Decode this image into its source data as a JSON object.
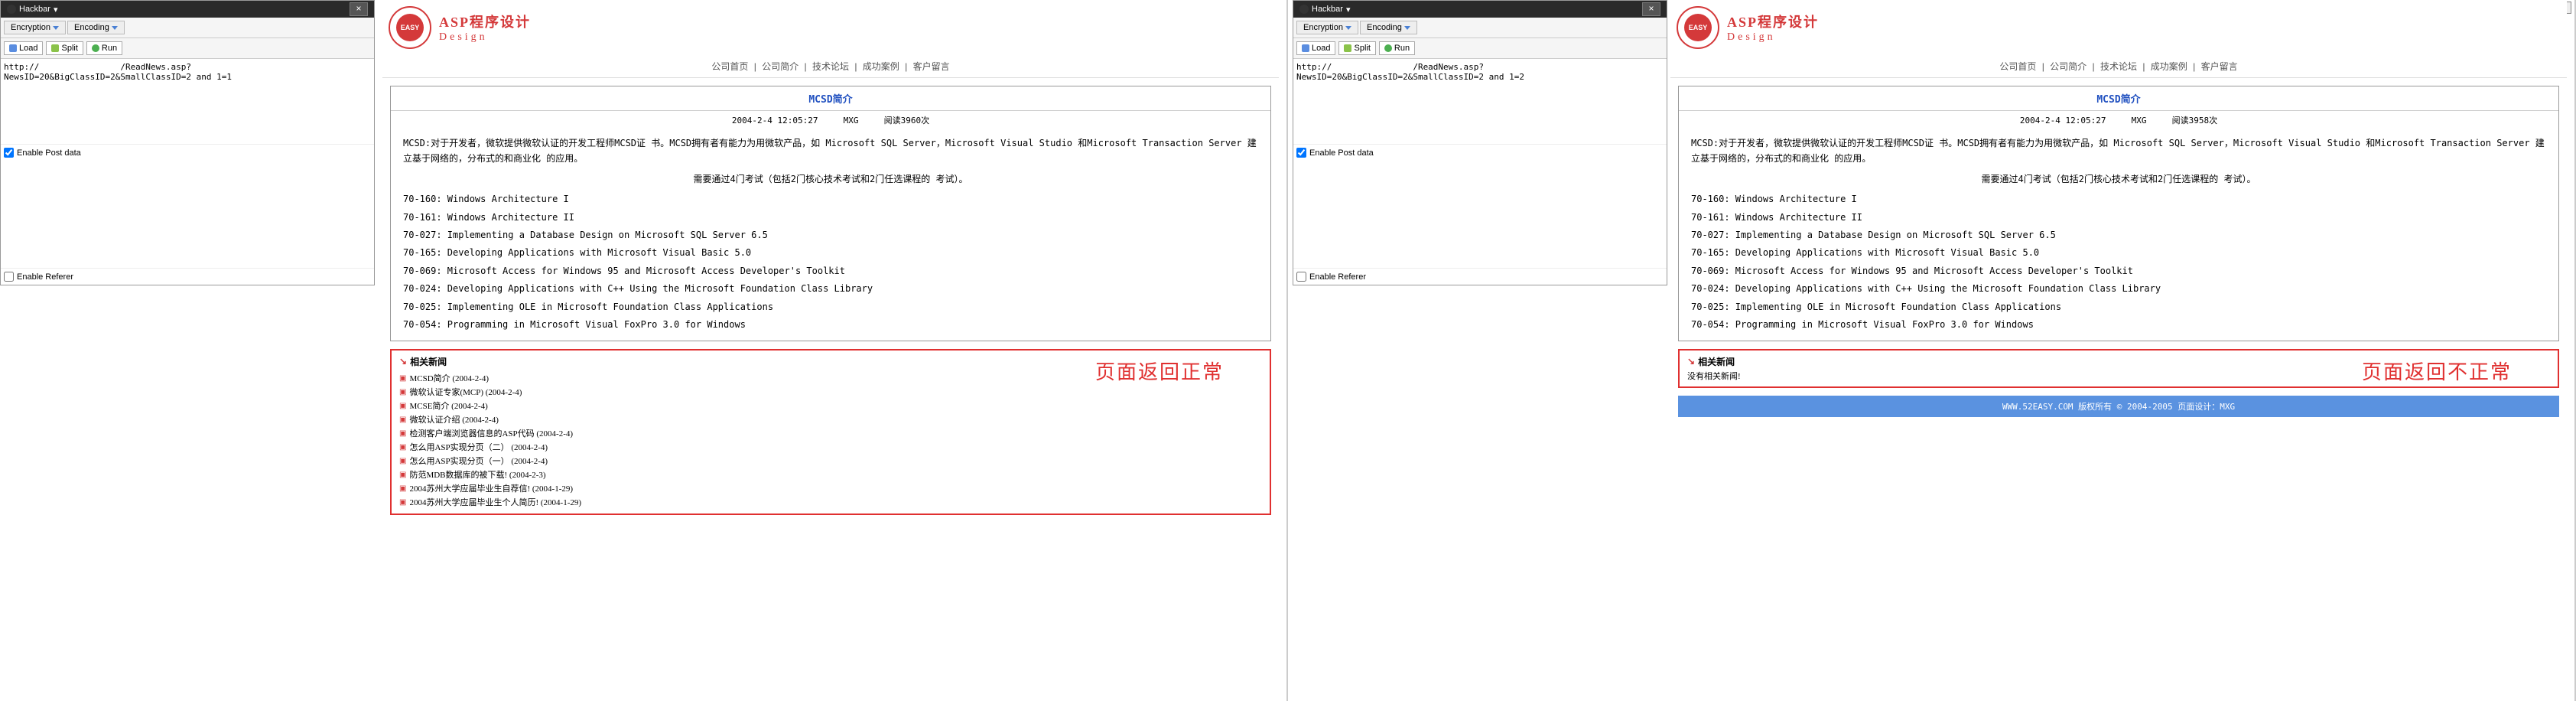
{
  "hackbar": {
    "title": "Hackbar",
    "encryption_label": "Encryption",
    "encoding_label": "Encoding",
    "load_label": "Load",
    "split_label": "Split",
    "run_label": "Run",
    "enable_post_label": "Enable Post data",
    "enable_referer_label": "Enable Referer"
  },
  "left": {
    "url_value": "http://                /ReadNews.asp?NewsID=20&BigClassID=2&SmallClassID=2 and 1=1",
    "post_checked": true,
    "referer_checked": false,
    "related_overlay": "页面返回正常",
    "meta_views": "阅读3960次",
    "related_items": [
      "MCSD简介 (2004-2-4)",
      "微软认证专家(MCP) (2004-2-4)",
      "MCSE简介 (2004-2-4)",
      "微软认证介绍 (2004-2-4)",
      "检测客户端浏览器信息的ASP代码 (2004-2-4)",
      "怎么用ASP实现分页（二） (2004-2-4)",
      "怎么用ASP实现分页（一） (2004-2-4)",
      "防范MDB数据库的被下载! (2004-2-3)",
      "2004苏州大学应届毕业生自荐信! (2004-1-29)",
      "2004苏州大学应届毕业生个人简历! (2004-1-29)"
    ]
  },
  "right": {
    "url_value": "http://                /ReadNews.asp?NewsID=20&BigClassID=2&SmallClassID=2 and 1=2",
    "post_checked": true,
    "referer_checked": false,
    "related_overlay": "页面返回不正常",
    "meta_views": "阅读3958次",
    "related_none": "没有相关新闻!",
    "win_min": "—",
    "win_close": "X"
  },
  "site": {
    "logo_text": "EASY",
    "title_main": "ASP程序设计",
    "title_sub": "Design",
    "nav_items": [
      "公司首页",
      "公司简介",
      "技术论坛",
      "成功案例",
      "客户留言"
    ],
    "nav_sep": " | ",
    "footer": "WWW.52EASY.COM 版权所有 © 2004-2005 页面设计：MXG"
  },
  "article": {
    "title": "MCSD简介",
    "meta_date": "2004-2-4 12:05:27",
    "meta_author": "MXG",
    "intro": "MCSD:对于开发者，微软提供微软认证的开发工程师MCSD证 书。MCSD拥有者有能力为用微软产品，如 Microsoft SQL Server，Microsoft Visual Studio 和Microsoft Transaction Server 建立基于网络的，分布式的和商业化 的应用。",
    "requirement": "需要通过4门考试（包括2门核心技术考试和2门任选课程的 考试）。",
    "certs": [
      "70-160: Windows Architecture I",
      "70-161: Windows Architecture II",
      "70-027: Implementing a Database Design on Microsoft SQL Server 6.5",
      "70-165: Developing Applications with Microsoft Visual Basic 5.0",
      "70-069: Microsoft Access for Windows 95 and Microsoft Access Developer's Toolkit",
      "70-024: Developing Applications with C++ Using the Microsoft Foundation Class Library",
      "70-025: Implementing OLE in Microsoft Foundation Class Applications",
      "70-054: Programming in Microsoft Visual FoxPro 3.0 for Windows"
    ],
    "related_title": "相关新闻"
  }
}
